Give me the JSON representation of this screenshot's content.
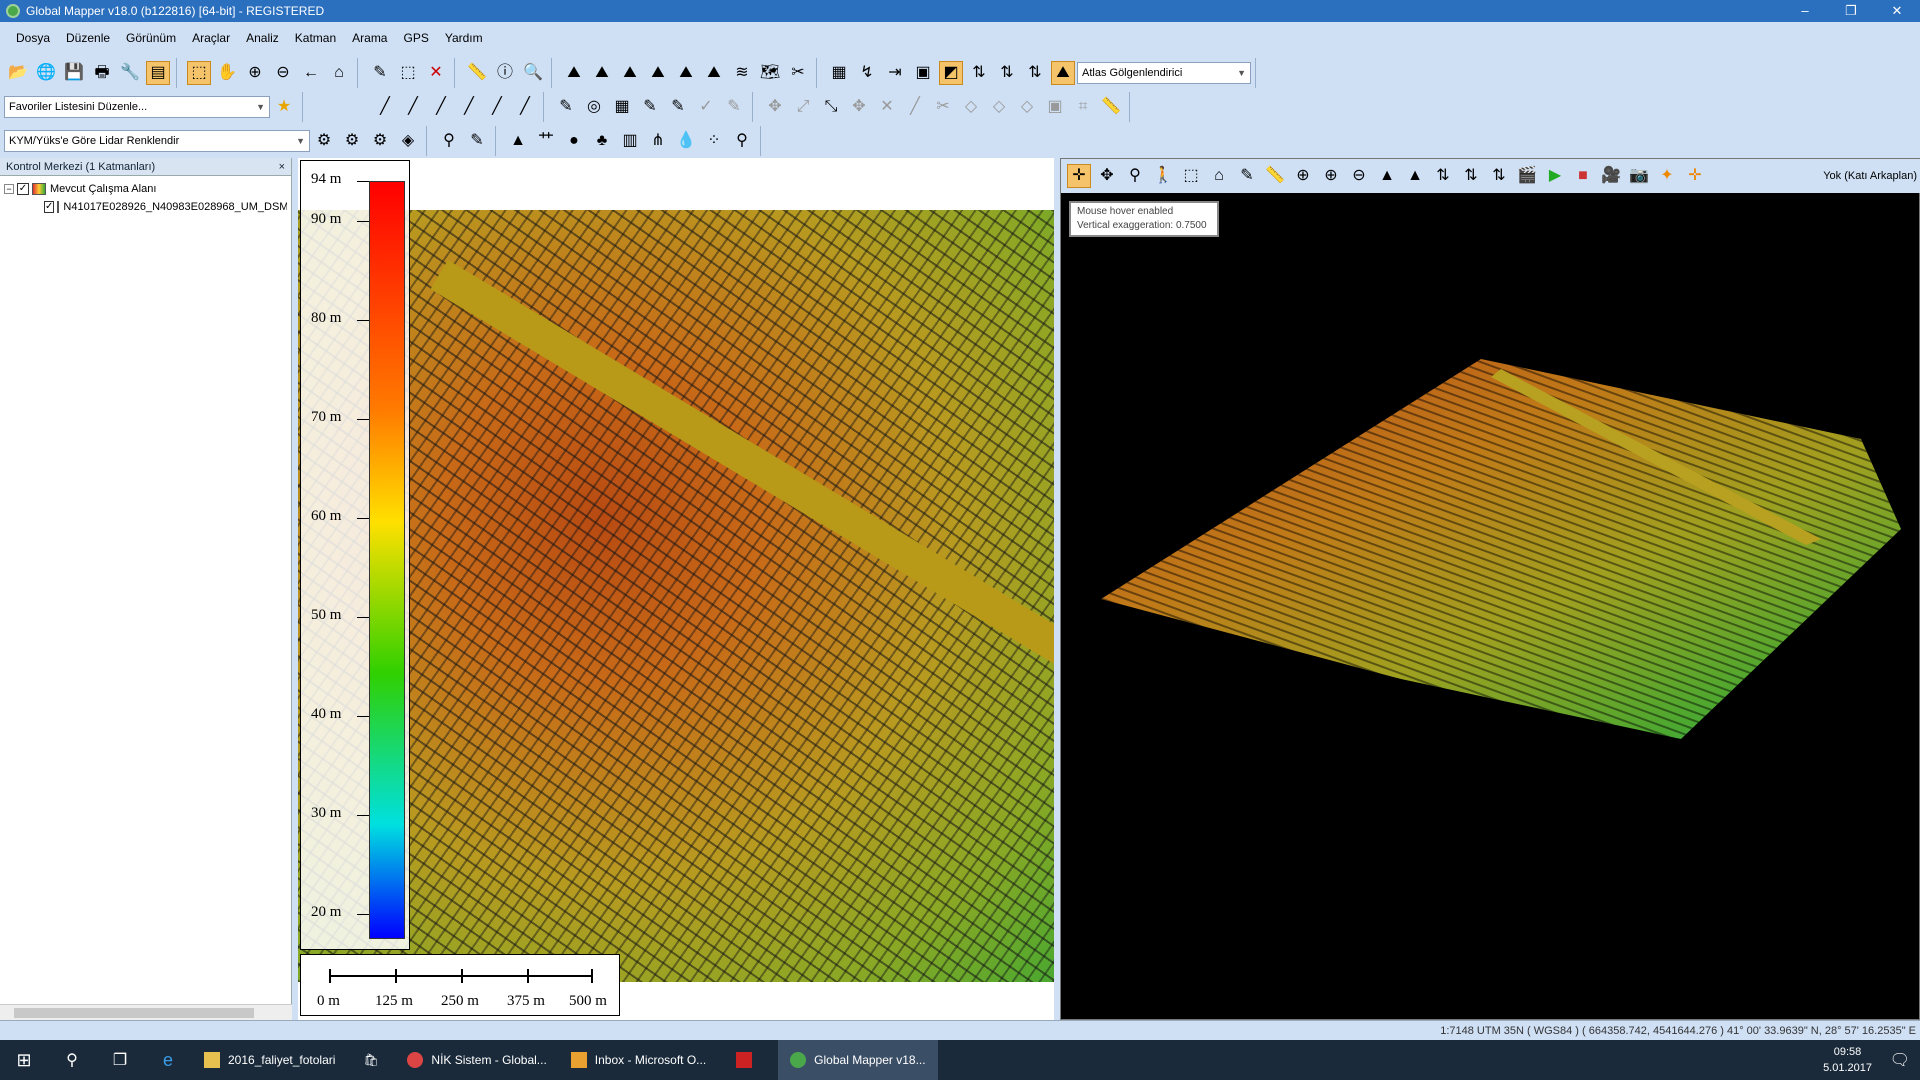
{
  "window": {
    "title": "Global Mapper v18.0 (b122816) [64-bit] - REGISTERED",
    "min": "–",
    "max": "❐",
    "close": "✕"
  },
  "menu": [
    "Dosya",
    "Düzenle",
    "Görünüm",
    "Araçlar",
    "Analiz",
    "Katman",
    "Arama",
    "GPS",
    "Yardım"
  ],
  "toolbar": {
    "shader": "Atlas Gölgenlendirici",
    "favorites": "Favoriler Listesini Düzenle...",
    "lidar": "KYM/Yüks'e Göre Lidar Renklendir"
  },
  "control_center": {
    "title": "Kontrol Merkezi (1 Katmanları)",
    "close": "×",
    "root": "Mevcut Çalışma Alanı",
    "layer": "N41017E028926_N40983E028968_UM_DSM"
  },
  "legend": {
    "top": "94 m",
    "ticks": [
      "90 m",
      "80 m",
      "70 m",
      "60 m",
      "50 m",
      "40 m",
      "30 m",
      "20 m"
    ]
  },
  "scale": [
    "0 m",
    "125 m",
    "250 m",
    "375 m",
    "500 m"
  ],
  "view3d": {
    "background": "Yok (Katı Arkaplan)",
    "tooltip_line1": "Mouse hover enabled",
    "tooltip_line2": "Vertical exaggeration: 0.7500"
  },
  "status": "1:7148  UTM 35N ( WGS84 ) ( 664358.742, 4541644.276 )  41° 00' 33.9639\" N, 28° 57' 16.2535\" E",
  "taskbar": {
    "items": [
      "2016_faliyet_fotolari",
      "NİK Sistem - Global...",
      "Inbox - Microsoft O...",
      "",
      "Global Mapper v18..."
    ],
    "time": "09:58",
    "date": "5.01.2017"
  }
}
